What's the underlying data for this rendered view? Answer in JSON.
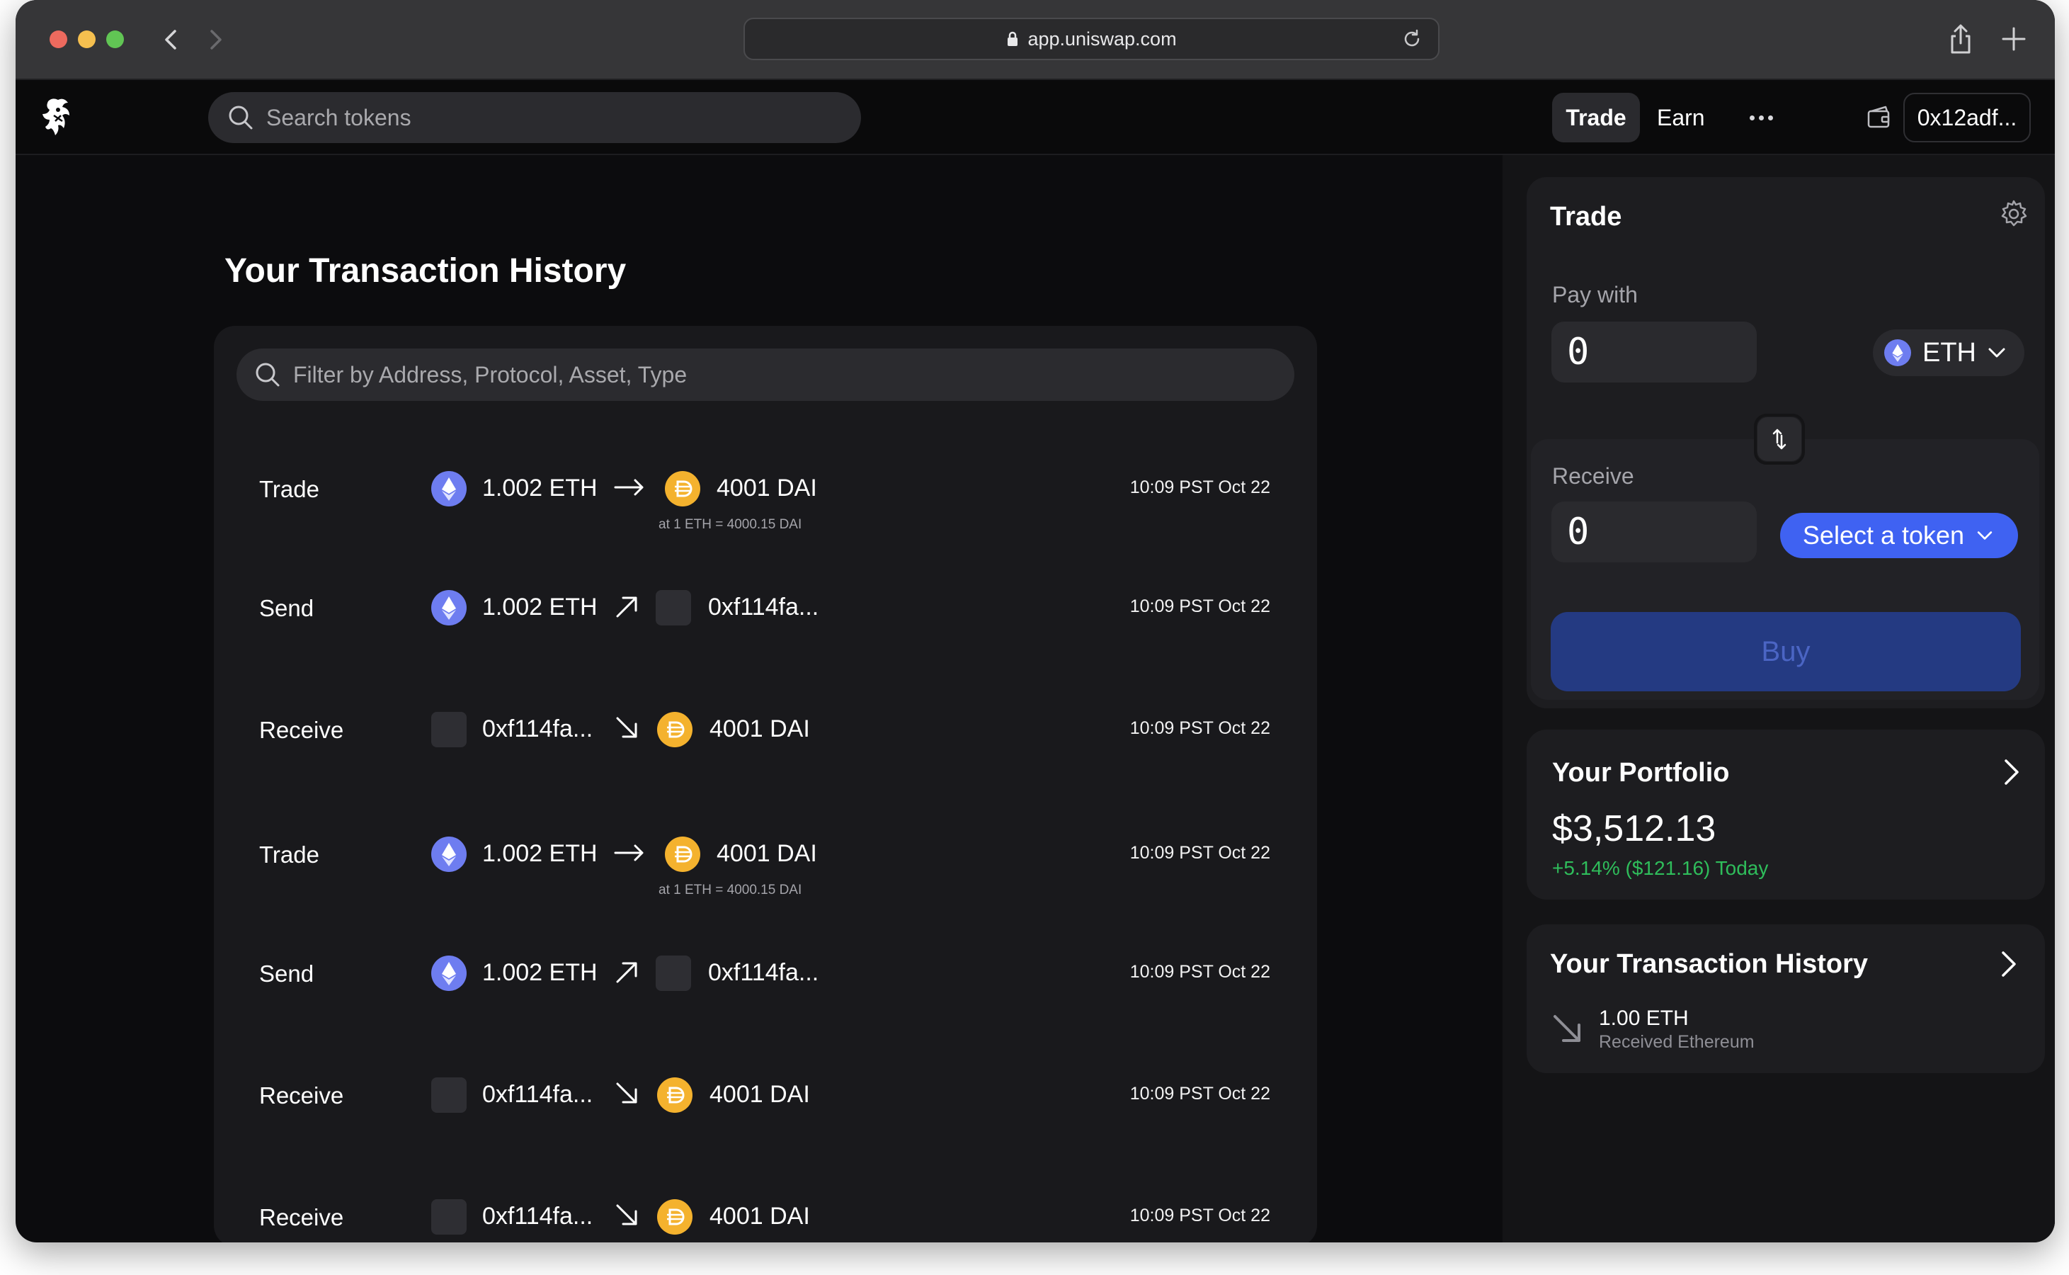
{
  "browser": {
    "url": "app.uniswap.com"
  },
  "header": {
    "search_placeholder": "Search tokens",
    "nav_trade": "Trade",
    "nav_earn": "Earn",
    "wallet_address": "0x12adf..."
  },
  "history": {
    "title": "Your Transaction History",
    "filter_placeholder": "Filter by Address, Protocol, Asset, Type",
    "rows": [
      {
        "type": "Trade",
        "from": "1.002 ETH",
        "to": "4001 DAI",
        "rate": "at 1 ETH = 4000.15 DAI",
        "time": "10:09 PST Oct 22"
      },
      {
        "type": "Send",
        "from": "1.002 ETH",
        "to": "0xf114fa...",
        "time": "10:09 PST Oct 22"
      },
      {
        "type": "Receive",
        "from": "0xf114fa...",
        "to": "4001 DAI",
        "time": "10:09 PST Oct 22"
      },
      {
        "type": "Trade",
        "from": "1.002 ETH",
        "to": "4001 DAI",
        "rate": "at 1 ETH = 4000.15 DAI",
        "time": "10:09 PST Oct 22"
      },
      {
        "type": "Send",
        "from": "1.002 ETH",
        "to": "0xf114fa...",
        "time": "10:09 PST Oct 22"
      },
      {
        "type": "Receive",
        "from": "0xf114fa...",
        "to": "4001 DAI",
        "time": "10:09 PST Oct 22"
      },
      {
        "type": "Receive",
        "from": "0xf114fa...",
        "to": "4001 DAI",
        "time": "10:09 PST Oct 22"
      }
    ]
  },
  "trade_widget": {
    "title": "Trade",
    "pay_label": "Pay with",
    "pay_amount": "0",
    "pay_token": "ETH",
    "receive_label": "Receive",
    "receive_amount": "0",
    "select_token_label": "Select a token",
    "buy_label": "Buy"
  },
  "portfolio": {
    "title": "Your Portfolio",
    "value": "$3,512.13",
    "change": "+5.14% ($121.16) Today"
  },
  "history_summary": {
    "title": "Your Transaction History",
    "latest_amount": "1.00 ETH",
    "latest_desc": "Received Ethereum"
  },
  "colors": {
    "accent": "#3f62f2",
    "eth": "#6e7df0",
    "dai": "#f4b22e",
    "positive": "#2fbd5b"
  }
}
